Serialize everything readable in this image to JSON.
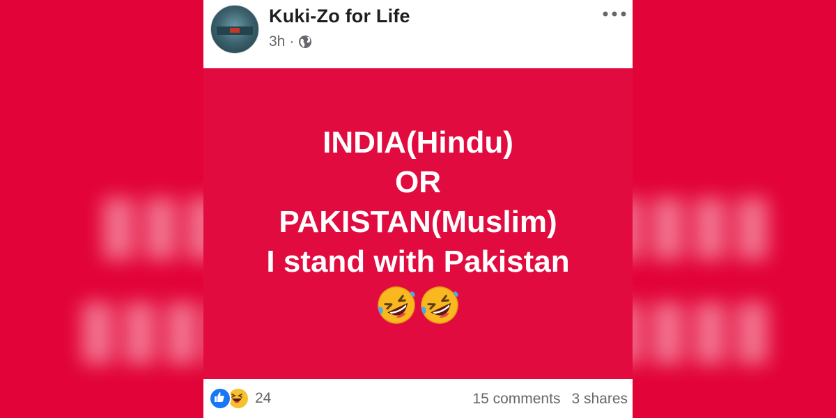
{
  "post": {
    "author": "Kuki-Zo for Life",
    "time": "3h",
    "separator": "·",
    "privacy_icon": "globe-icon",
    "menu_icon": "more-options-icon",
    "text_lines": [
      "INDIA(Hindu)",
      "OR",
      "PAKISTAN(Muslim)",
      "I stand with Pakistan"
    ],
    "emoji": [
      "rolling-on-floor-laughing-icon",
      "rolling-on-floor-laughing-icon"
    ],
    "background_color": "#e10b3f"
  },
  "footer": {
    "reaction_icons": [
      "like-icon",
      "haha-icon"
    ],
    "reaction_count": "24",
    "comments": "15 comments",
    "shares": "3 shares"
  },
  "colors": {
    "outer_background": "#e0033a",
    "like_blue": "#1877f2",
    "haha_yellow": "#f7c02e",
    "meta_gray": "#65676b"
  }
}
